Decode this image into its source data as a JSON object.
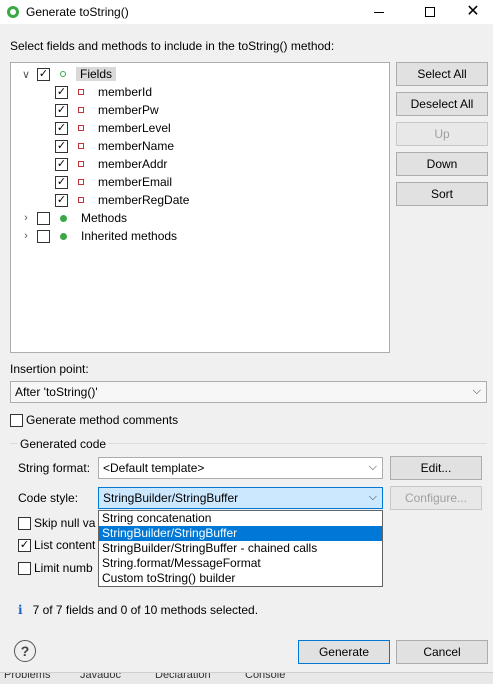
{
  "window": {
    "title": "Generate toString()",
    "minimize_icon": "minimize-icon",
    "maximize_icon": "maximize-icon",
    "close_icon": "close-icon"
  },
  "instructions": "Select fields and methods to include in the toString() method:",
  "tree": {
    "fields_label": "Fields",
    "fields": [
      "memberId",
      "memberPw",
      "memberLevel",
      "memberName",
      "memberAddr",
      "memberEmail",
      "memberRegDate"
    ],
    "methods_label": "Methods",
    "inherited_label": "Inherited methods",
    "check_mark": "✓",
    "expand_glyph": "›",
    "collapse_glyph": "∨"
  },
  "side_buttons": {
    "select_all": "Select All",
    "deselect_all": "Deselect All",
    "up": "Up",
    "down": "Down",
    "sort": "Sort"
  },
  "insertion_point": {
    "label": "Insertion point:",
    "value": "After 'toString()'"
  },
  "generate_comments_label": "Generate method comments",
  "generated_code": {
    "group_label": "Generated code",
    "string_format_label": "String format:",
    "string_format_value": "<Default template>",
    "edit_button": "Edit...",
    "code_style_label": "Code style:",
    "code_style_value": "StringBuilder/StringBuffer",
    "configure_button": "Configure...",
    "code_style_options": [
      "String concatenation",
      "StringBuilder/StringBuffer",
      "StringBuilder/StringBuffer - chained calls",
      "String.format/MessageFormat",
      "Custom toString() builder"
    ],
    "skip_null_label": "Skip null va",
    "list_contents_label": "List content",
    "limit_number_label": "Limit numb"
  },
  "status": {
    "icon": "i",
    "text": "7 of 7 fields and 0 of 10 methods selected."
  },
  "footer": {
    "help_icon": "?",
    "generate_button": "Generate",
    "cancel_button": "Cancel"
  },
  "background_tabs": [
    "Problems",
    "Javadoc",
    "Declaration",
    "Console"
  ],
  "colors": {
    "accent": "#0078d7",
    "field_icon": "#c4343b",
    "method_icon": "#3aa845",
    "selection": "#cce8ff"
  }
}
